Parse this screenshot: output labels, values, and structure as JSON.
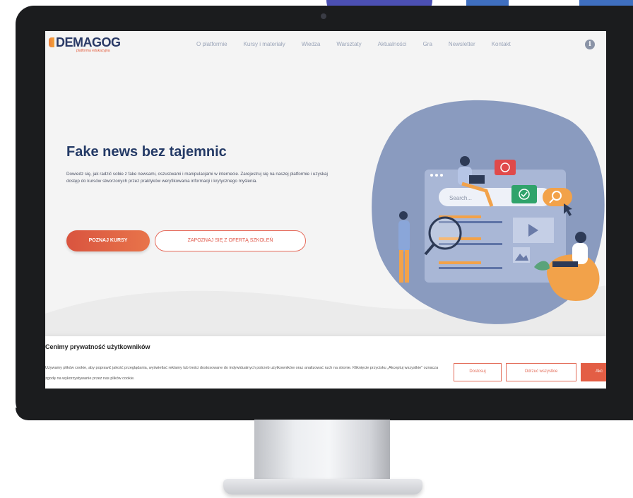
{
  "site": {
    "logo_text": "DEMAGOG",
    "logo_tagline": "platforma edukacyjna",
    "nav": [
      {
        "label": "O platformie"
      },
      {
        "label": "Kursy i materiały"
      },
      {
        "label": "Wiedza"
      },
      {
        "label": "Warsztaty"
      },
      {
        "label": "Aktualności"
      },
      {
        "label": "Gra"
      },
      {
        "label": "Newsletter"
      },
      {
        "label": "Kontakt"
      }
    ],
    "info_icon": "i"
  },
  "hero": {
    "title": "Fake news bez tajemnic",
    "description": "Dowiedz się, jak radzić sobie z fake newsami, oszustwami i manipulacjami w internecie. Zarejestruj się na naszej platformie i uzyskaj dostęp do kursów stworzonych przez praktyków weryfikowania informacji i krytycznego myślenia.",
    "primary_button": "POZNAJ KURSY",
    "secondary_button": "ZAPOZNAJ SIĘ Z OFERTĄ SZKOLEŃ"
  },
  "illustration": {
    "search_placeholder": "Search...",
    "icons": [
      "magnifier-icon",
      "play-icon",
      "image-icon",
      "check-icon",
      "x-icon",
      "cursor-icon"
    ]
  },
  "cookie": {
    "title": "Cenimy prywatność użytkowników",
    "text": "Używamy plików cookie, aby poprawić jakość przeglądania, wyświetlać reklamy lub treści dostosowane do indywidualnych potrzeb użytkowników oraz analizować ruch na stronie. Kliknięcie przycisku „Akceptuj wszystkie\" oznacza zgodę na wykorzystywanie przez nas plików cookie.",
    "btn_customize": "Dostosuj",
    "btn_reject": "Odrzuć wszystkie",
    "btn_accept": "Akc"
  },
  "colors": {
    "brand_navy": "#243a66",
    "accent_coral": "#e35e45",
    "blob_blue": "#8a9bbf"
  }
}
